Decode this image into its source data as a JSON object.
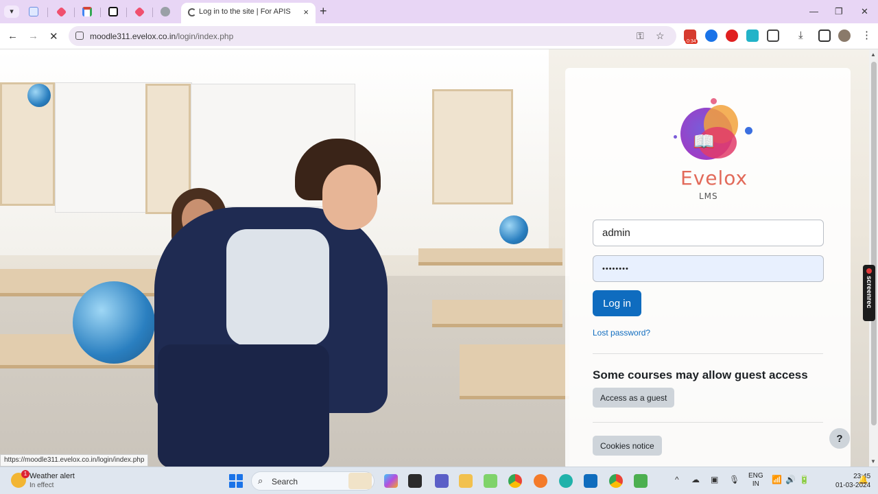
{
  "tabs": {
    "active_title": "Log in to the site | For APIS",
    "close_glyph": "×",
    "new_tab_glyph": "+"
  },
  "toolbar": {
    "url_host": "moodle311.evelox.co.in",
    "url_path": "/login/index.php",
    "badge": "0:34"
  },
  "login": {
    "logo_text": "Evelox",
    "logo_sub": "LMS",
    "username_value": "admin",
    "password_value": "••••••••",
    "login_button": "Log in",
    "lost_password": "Lost password?",
    "guest_heading": "Some courses may allow guest access",
    "guest_button": "Access as a guest",
    "cookies_button": "Cookies notice",
    "help_glyph": "?"
  },
  "screenrec": {
    "label": "screenrec"
  },
  "status_bar": {
    "url": "https://moodle311.evelox.co.in/login/index.php"
  },
  "taskbar": {
    "weather_title": "Weather alert",
    "weather_sub": "In effect",
    "weather_badge": "1",
    "search_placeholder": "Search",
    "lang_line1": "ENG",
    "lang_line2": "IN",
    "time": "23:45",
    "date": "01-03-2024"
  },
  "colors": {
    "accent": "#0f6cbf",
    "tab_strip": "#e8d6f5",
    "logo_text": "#e26a5a"
  }
}
